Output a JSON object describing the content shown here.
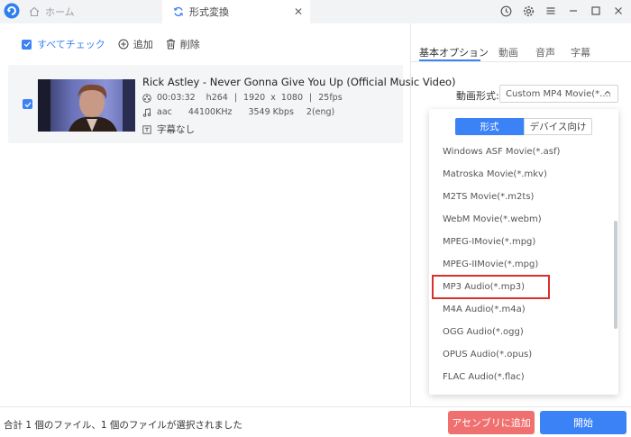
{
  "titlebar": {
    "home_tab": "ホーム",
    "convert_tab": "形式変換"
  },
  "toolbar": {
    "select_all": "すべてチェック",
    "add": "追加",
    "delete": "削除"
  },
  "file": {
    "title": "Rick Astley - Never Gonna Give You Up (Official Music Video)",
    "duration": "00:03:32",
    "codec": "h264",
    "width": "1920",
    "x": "x",
    "height": "1080",
    "fps": "25fps",
    "audio_codec": "aac",
    "sample_rate": "44100KHz",
    "bitrate": "3549 Kbps",
    "channels": "2(eng)",
    "subtitle": "字幕なし",
    "sep": "|"
  },
  "right_tabs": [
    "基本オプション",
    "動画",
    "音声",
    "字幕"
  ],
  "format": {
    "label": "動画形式:",
    "selected": "Custom MP4 Movie(*...."
  },
  "dropdown": {
    "seg_format": "形式",
    "seg_device": "デバイス向け",
    "options": [
      "Windows ASF Movie(*.asf)",
      "Matroska Movie(*.mkv)",
      "M2TS Movie(*.m2ts)",
      "WebM Movie(*.webm)",
      "MPEG-IMovie(*.mpg)",
      "MPEG-IIMovie(*.mpg)",
      "MP3 Audio(*.mp3)",
      "M4A Audio(*.m4a)",
      "OGG Audio(*.ogg)",
      "OPUS Audio(*.opus)",
      "FLAC Audio(*.flac)"
    ]
  },
  "footer": {
    "status": "合計 1 個のファイル、1 個のファイルが選択されました",
    "merge_button": "アセンブリに追加",
    "start_button": "開始"
  },
  "colors": {
    "accent": "#3b82f6",
    "merge": "#f07070",
    "highlight": "#d9302b"
  }
}
